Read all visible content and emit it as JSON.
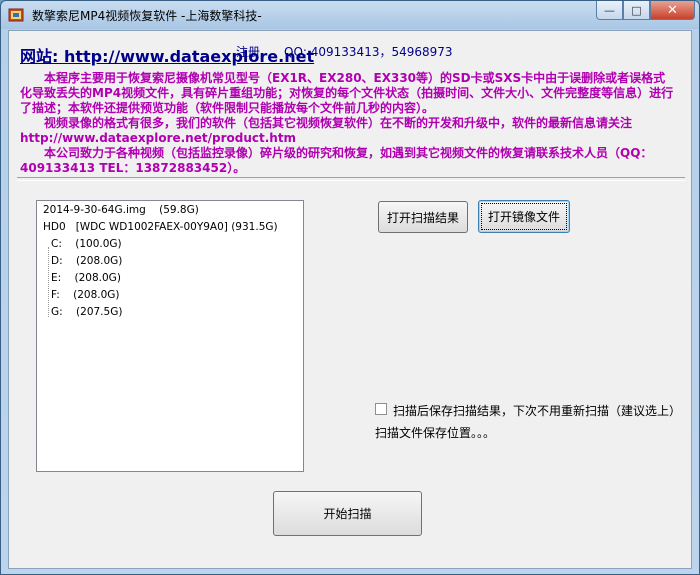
{
  "window": {
    "title": "数擎索尼MP4视频恢复软件  -上海数擎科技-",
    "min_glyph": "—",
    "max_glyph": "□",
    "close_glyph": "✕"
  },
  "header": {
    "site_label": "网站: http://www.dataexplore.net",
    "register_label": "注册",
    "qq_label": "QQ:  409133413，54968973"
  },
  "description": [
    "本程序主要用于恢复索尼摄像机常见型号（EX1R、EX280、EX330等）的SD卡或SXS卡中由于误删除或者误格式化导致丢失的MP4视频文件，具有碎片重组功能；对恢复的每个文件状态（拍摄时间、文件大小、文件完整度等信息）进行了描述；本软件还提供预览功能（软件限制只能播放每个文件前几秒的内容）。",
    "视频录像的格式有很多，我们的软件（包括其它视频恢复软件）在不断的开发和升级中，软件的最新信息请关注 http://www.dataexplore.net/product.htm",
    "本公司致力于各种视频（包括监控录像）碎片级的研究和恢复，如遇到其它视频文件的恢复请联系技术人员（QQ：409133413  TEL：13872883452）。"
  ],
  "tree": {
    "items": [
      {
        "name": "2014-9-30-64G.img",
        "size": "(59.8G)"
      },
      {
        "name": "HD0",
        "size": "[WDC WD1002FAEX-00Y9A0]  (931.5G)"
      },
      {
        "name": "C:",
        "size": "(100.0G)"
      },
      {
        "name": "D:",
        "size": "(208.0G)"
      },
      {
        "name": "E:",
        "size": "(208.0G)"
      },
      {
        "name": "F:",
        "size": "(208.0G)"
      },
      {
        "name": "G:",
        "size": "(207.5G)"
      }
    ]
  },
  "buttons": {
    "open_scan_result": "打开扫描结果",
    "open_image_file": "打开镜像文件",
    "start_scan": "开始扫描"
  },
  "options": {
    "save_scan_checkbox_label": "扫描后保存扫描结果，下次不用重新扫描（建议选上）",
    "save_scan_checked": false,
    "save_path_label": "扫描文件保存位置。。。"
  }
}
